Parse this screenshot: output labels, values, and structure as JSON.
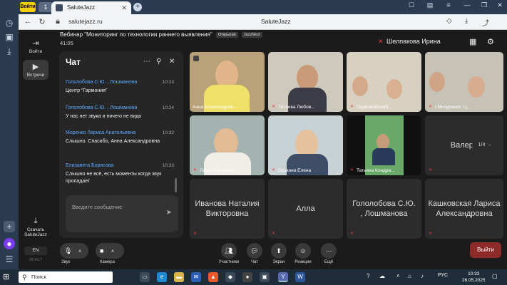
{
  "browser": {
    "yandex_badge": "Войти",
    "tab_count": "1",
    "tab_title": "SaluteJazz",
    "url": "salutejazz.ru",
    "page_title": "SaluteJazz"
  },
  "nav": {
    "login": "Войти",
    "meetings": "Встречи",
    "download": "Скачать SaluteJazz",
    "lang": "EN",
    "version": "25.41.7"
  },
  "meeting": {
    "title": "Вебинар \"Мониторинг по технологии раннего выявления\"",
    "badge_open": "Открытая",
    "badge_jazznext": "JazzNext",
    "time": "41:05",
    "host": "Шелпакова Ирина"
  },
  "chat": {
    "title": "Чат",
    "messages": [
      {
        "author": "Гололобова С.Ю. , Лошманова",
        "time": "10:23",
        "text": "Центр \"Гармония\""
      },
      {
        "author": "Гололобова С.Ю. , Лошманова",
        "time": "10:24",
        "text": "У нас нет звука и ничего не видо"
      },
      {
        "author": "Моренко Лариса Анатольевна",
        "time": "10:32",
        "text": "Слышно. Спасибо, Анна Александровна"
      },
      {
        "author": "Елизавета Борисова",
        "time": "10:33",
        "text": "Слышно не всё, есть моменты когда звук пропадает"
      }
    ],
    "placeholder": "Введите сообщение"
  },
  "tiles": [
    {
      "label": "Анна Александров..."
    },
    {
      "label": "Титаева Любов..."
    },
    {
      "label": "Первомайский ..."
    },
    {
      "label": "г.Мичуринск, Ц..."
    },
    {
      "label": "Лариса Васильe..."
    },
    {
      "label": "Оськина Елена"
    },
    {
      "label": "Татьяна Кондра..."
    },
    {
      "label": "Валерий"
    },
    {
      "name": "Иванова Наталия Викторовна"
    },
    {
      "name": "Алла"
    },
    {
      "name": "Гололобова С.Ю. , Лошманова"
    },
    {
      "name": "Кашковская Лариса Александровна"
    }
  ],
  "pager": "1/4",
  "toolbar": {
    "sound": "Звук",
    "camera": "Камера",
    "participants": "Участники",
    "chat": "Чат",
    "screen": "Экран",
    "reactions": "Реакции",
    "more": "Ещё",
    "leave": "Выйти"
  },
  "taskbar": {
    "search": "Поиск",
    "lang": "РУС",
    "time": "10:33",
    "date": "26.05.2025"
  }
}
